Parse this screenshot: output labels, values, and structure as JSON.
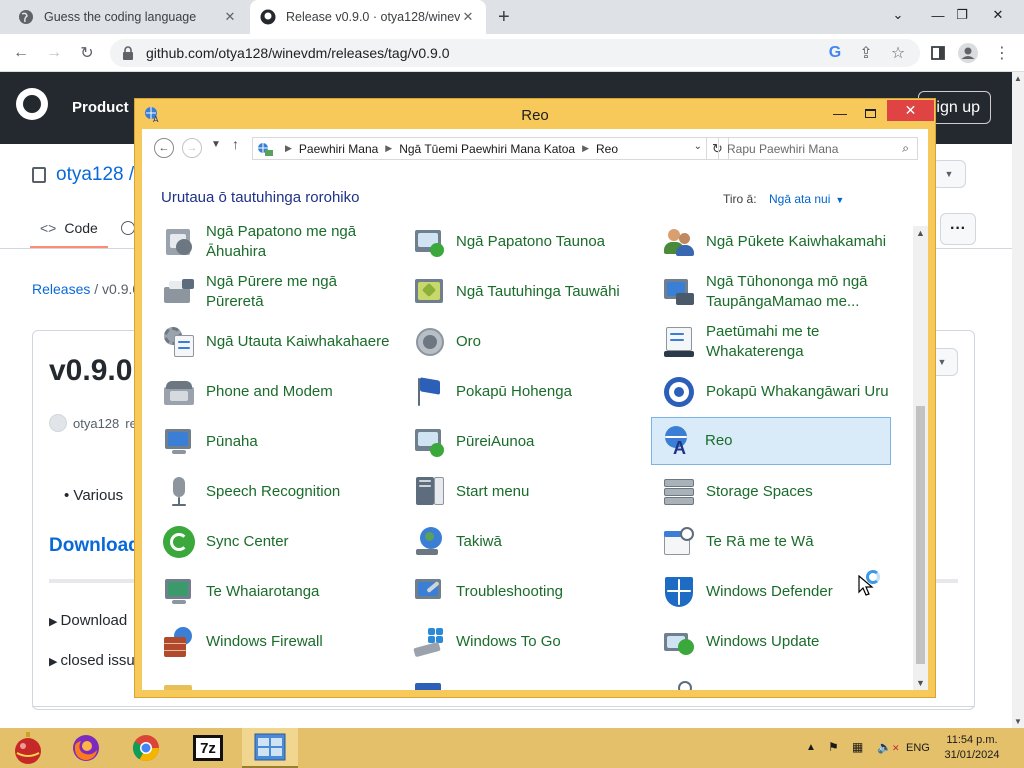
{
  "browser": {
    "tabs": [
      {
        "title": "Guess the coding language",
        "active": false
      },
      {
        "title": "Release v0.9.0 · otya128/winevdm",
        "active": true
      }
    ],
    "new_tab": "+",
    "url": "github.com/otya128/winevdm/releases/tag/v0.9.0"
  },
  "github": {
    "nav_product": "Product",
    "sign_up": "Sign up",
    "repo": "otya128 /",
    "tab_code": "Code",
    "breadcrumb_releases": "Releases",
    "breadcrumb_version": "v0.9.0",
    "release_title": "v0.9.0",
    "author": "otya128",
    "author_suffix": "re",
    "bullet_text": "Various",
    "download_heading": "Download",
    "details": [
      "Download",
      "closed issu"
    ]
  },
  "control_panel": {
    "window_title": "Reo",
    "breadcrumb": [
      "Paewhiri Mana",
      "Ngā Tūemi Paewhiri Mana Katoa",
      "Reo"
    ],
    "search_placeholder": "Rapu Paewhiri Mana",
    "heading": "Urutaua ō tautuhinga rorohiko",
    "view_by_label": "Tiro ā:",
    "view_by_value": "Ngā ata nui",
    "items": [
      {
        "label": "Ngā Papatono me ngā Āhuahira",
        "icon": "programs-features-icon"
      },
      {
        "label": "Ngā Papatono Taunoa",
        "icon": "default-programs-icon"
      },
      {
        "label": "Ngā Pūkete Kaiwhakamahi",
        "icon": "user-accounts-icon"
      },
      {
        "label": "Ngā Pūrere me ngā Pūreretā",
        "icon": "devices-printers-icon"
      },
      {
        "label": "Ngā Tautuhinga Tauwāhi",
        "icon": "location-settings-icon"
      },
      {
        "label": "Ngā Tūhononga mō ngā TaupāngaMamao me...",
        "icon": "remoteapp-icon"
      },
      {
        "label": "Ngā Utauta Kaiwhakahaere",
        "icon": "admin-tools-icon"
      },
      {
        "label": "Oro",
        "icon": "sound-icon"
      },
      {
        "label": "Paetūmahi me te Whakaterenga",
        "icon": "taskbar-navigation-icon"
      },
      {
        "label": "Phone and Modem",
        "icon": "phone-modem-icon"
      },
      {
        "label": "Pokapū Hohenga",
        "icon": "action-center-flag-icon"
      },
      {
        "label": "Pokapū Whakangāwari Uru",
        "icon": "ease-of-access-icon"
      },
      {
        "label": "Pūnaha",
        "icon": "system-icon"
      },
      {
        "label": "PūreiAunoa",
        "icon": "autoplay-icon"
      },
      {
        "label": "Reo",
        "icon": "language-icon",
        "selected": true
      },
      {
        "label": "Speech Recognition",
        "icon": "microphone-icon"
      },
      {
        "label": "Start menu",
        "icon": "start-menu-icon"
      },
      {
        "label": "Storage Spaces",
        "icon": "storage-spaces-icon"
      },
      {
        "label": "Sync Center",
        "icon": "sync-center-icon"
      },
      {
        "label": "Takiwā",
        "icon": "region-globe-icon"
      },
      {
        "label": "Te Rā me te Wā",
        "icon": "date-time-icon"
      },
      {
        "label": "Te Whaiarotanga",
        "icon": "personalization-icon"
      },
      {
        "label": "Troubleshooting",
        "icon": "troubleshooting-icon"
      },
      {
        "label": "Windows Defender",
        "icon": "windows-defender-icon"
      },
      {
        "label": "Windows Firewall",
        "icon": "windows-firewall-icon"
      },
      {
        "label": "Windows To Go",
        "icon": "windows-to-go-icon"
      },
      {
        "label": "Windows Update",
        "icon": "windows-update-icon"
      }
    ]
  },
  "taskbar": {
    "lang": "ENG",
    "time": "11:54 p.m.",
    "date": "31/01/2024",
    "apps": [
      "start-ornament-icon",
      "firefox-icon",
      "chrome-icon",
      "7zip-icon",
      "control-panel-icon"
    ],
    "sevenzip_label": "7z"
  }
}
